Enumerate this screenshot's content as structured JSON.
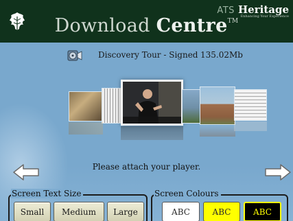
{
  "header": {
    "title_prefix": "Download",
    "title_bold": "Centre",
    "title_mark": "TM",
    "brand_ats": "ATS",
    "brand_name": "Heritage",
    "brand_tagline": "Enhancing Your Experience"
  },
  "track": {
    "name": "Discovery Tour - Signed",
    "size": "135.02Mb"
  },
  "prompt": "Please attach your player.",
  "text_size": {
    "legend": "Screen Text Size",
    "options": [
      "Small",
      "Medium",
      "Large"
    ]
  },
  "colours": {
    "legend": "Screen Colours",
    "options": [
      "ABC",
      "ABC",
      "ABC"
    ],
    "schemes": [
      {
        "bg": "#ffffff",
        "fg": "#2a2a2a"
      },
      {
        "bg": "#ffff00",
        "fg": "#2a2a2a"
      },
      {
        "bg": "#000000",
        "fg": "#ffff00"
      }
    ]
  },
  "theme": {
    "background": "#79a8cd",
    "header": "#10321c"
  }
}
